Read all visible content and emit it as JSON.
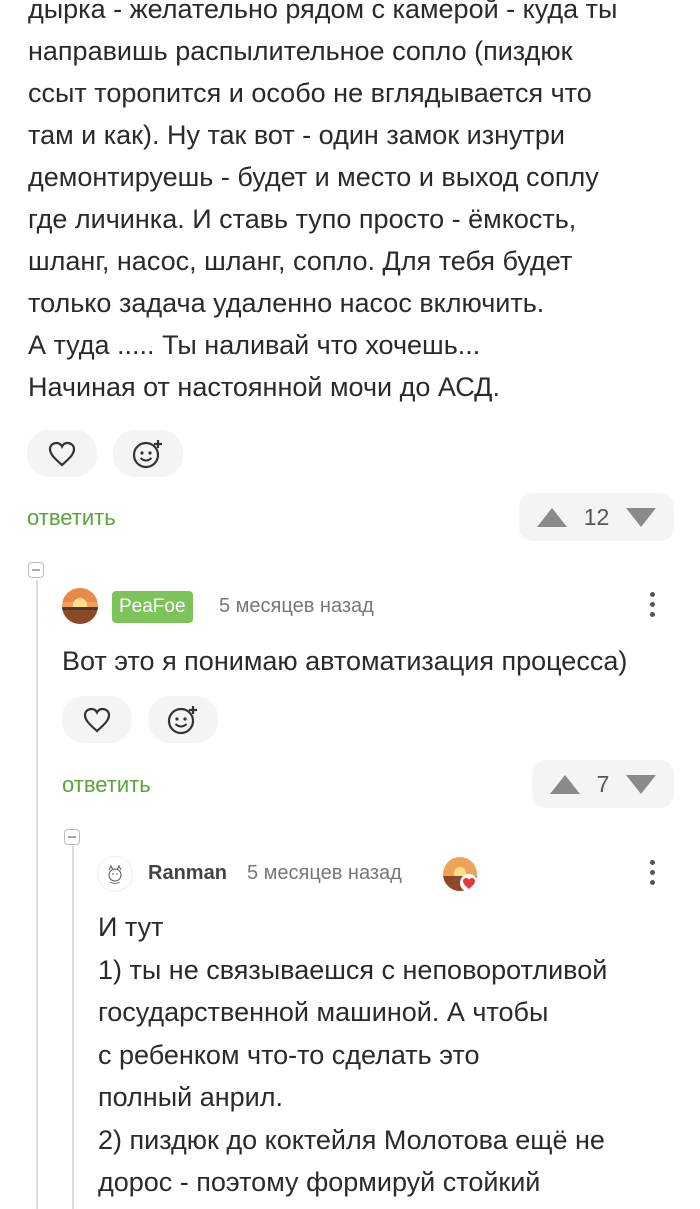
{
  "comment_top": {
    "text": "дырка - желательно рядом с камерой - куда ты\nнаправишь распылительное сопло (пиздюк\nссыт торопится и особо не вглядывается что\nтам и как). Ну так вот - один замок изнутри\nдемонтируешь - будет и место и выход соплу\nгде личинка. И ставь тупо просто - ёмкость,\nшланг, насос, шланг, сопло. Для тебя будет\nтолько задача удаленно насос включить.\nА туда ..... Ты наливай что хочешь...\nНачиная от настоянной мочи до АСД.",
    "reply_label": "ответить",
    "rating": "12"
  },
  "comment_peafoe": {
    "author": "PeaFoe",
    "time": "5 месяцев назад",
    "text": "Вот это я понимаю автоматизация процесса)",
    "reply_label": "ответить",
    "rating": "7"
  },
  "comment_ranman": {
    "author": "Ranman",
    "time": "5 месяцев назад",
    "text": "И тут\n1) ты не связываешся с неповоротливой\nгосударственной машиной. А чтобы\nс ребенком что-то сделать это\nполный анрил.\n2) пиздюк до коктейля Молотова ещё не\nдорос - поэтому формируй стойкий"
  },
  "colors": {
    "accent_green": "#5aa33a",
    "badge_green": "#7cc35a"
  }
}
